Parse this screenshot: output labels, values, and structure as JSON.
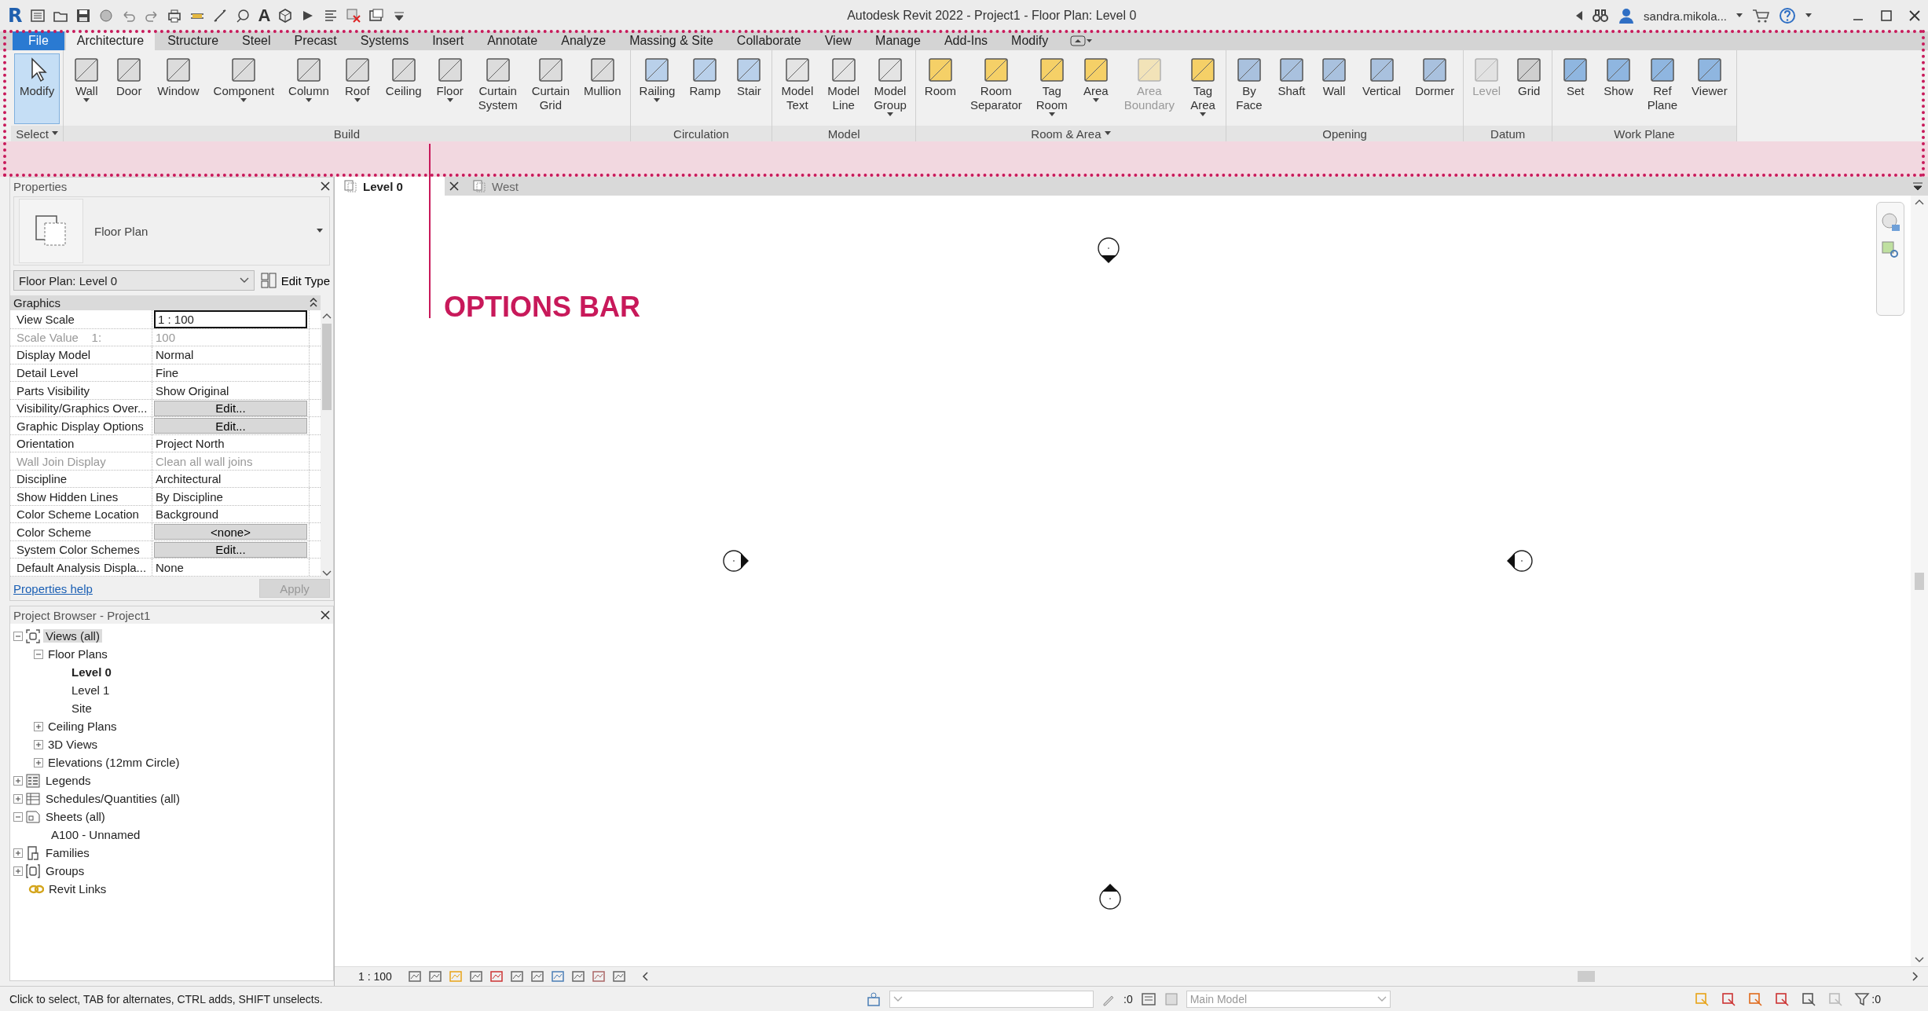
{
  "title_bar": {
    "logo": "R",
    "text_tool": "A",
    "title": "Autodesk Revit 2022 - Project1 - Floor Plan: Level 0",
    "user": "sandra.mikola..."
  },
  "ribbon": {
    "tabs": [
      {
        "label": "File",
        "kind": "application",
        "selected": false
      },
      {
        "label": "Architecture",
        "kind": "tab",
        "selected": true
      },
      {
        "label": "Structure",
        "kind": "tab",
        "selected": false
      },
      {
        "label": "Steel",
        "kind": "tab",
        "selected": false
      },
      {
        "label": "Precast",
        "kind": "tab",
        "selected": false
      },
      {
        "label": "Systems",
        "kind": "tab",
        "selected": false
      },
      {
        "label": "Insert",
        "kind": "tab",
        "selected": false
      },
      {
        "label": "Annotate",
        "kind": "tab",
        "selected": false
      },
      {
        "label": "Analyze",
        "kind": "tab",
        "selected": false
      },
      {
        "label": "Massing & Site",
        "kind": "tab",
        "selected": false
      },
      {
        "label": "Collaborate",
        "kind": "tab",
        "selected": false
      },
      {
        "label": "View",
        "kind": "tab",
        "selected": false
      },
      {
        "label": "Manage",
        "kind": "tab",
        "selected": false
      },
      {
        "label": "Add-Ins",
        "kind": "tab",
        "selected": false
      },
      {
        "label": "Modify",
        "kind": "tab",
        "selected": false
      }
    ],
    "panels": [
      {
        "title": "Select",
        "menu": true,
        "buttons": [
          {
            "label": "Modify",
            "selected": true,
            "disabled": false,
            "dropdown": false
          }
        ]
      },
      {
        "title": "Build",
        "menu": false,
        "buttons": [
          {
            "label": "Wall",
            "selected": false,
            "disabled": false,
            "dropdown": true
          },
          {
            "label": "Door",
            "selected": false,
            "disabled": false,
            "dropdown": false
          },
          {
            "label": "Window",
            "selected": false,
            "disabled": false,
            "dropdown": false
          },
          {
            "label": "Component",
            "selected": false,
            "disabled": false,
            "dropdown": true
          },
          {
            "label": "Column",
            "selected": false,
            "disabled": false,
            "dropdown": true
          },
          {
            "label": "Roof",
            "selected": false,
            "disabled": false,
            "dropdown": true
          },
          {
            "label": "Ceiling",
            "selected": false,
            "disabled": false,
            "dropdown": false
          },
          {
            "label": "Floor",
            "selected": false,
            "disabled": false,
            "dropdown": true
          },
          {
            "label": "Curtain\nSystem",
            "selected": false,
            "disabled": false,
            "dropdown": false
          },
          {
            "label": "Curtain\nGrid",
            "selected": false,
            "disabled": false,
            "dropdown": false
          },
          {
            "label": "Mullion",
            "selected": false,
            "disabled": false,
            "dropdown": false
          }
        ]
      },
      {
        "title": "Circulation",
        "menu": false,
        "buttons": [
          {
            "label": "Railing",
            "selected": false,
            "disabled": false,
            "dropdown": true
          },
          {
            "label": "Ramp",
            "selected": false,
            "disabled": false,
            "dropdown": false
          },
          {
            "label": "Stair",
            "selected": false,
            "disabled": false,
            "dropdown": false
          }
        ]
      },
      {
        "title": "Model",
        "menu": false,
        "buttons": [
          {
            "label": "Model\nText",
            "selected": false,
            "disabled": false,
            "dropdown": false
          },
          {
            "label": "Model\nLine",
            "selected": false,
            "disabled": false,
            "dropdown": false
          },
          {
            "label": "Model\nGroup",
            "selected": false,
            "disabled": false,
            "dropdown": true
          }
        ]
      },
      {
        "title": "Room & Area",
        "menu": true,
        "buttons": [
          {
            "label": "Room",
            "selected": false,
            "disabled": false,
            "dropdown": false
          },
          {
            "label": "Room\nSeparator",
            "selected": false,
            "disabled": false,
            "dropdown": false
          },
          {
            "label": "Tag\nRoom",
            "selected": false,
            "disabled": false,
            "dropdown": true
          },
          {
            "label": "Area",
            "selected": false,
            "disabled": false,
            "dropdown": true
          },
          {
            "label": "Area\nBoundary",
            "selected": false,
            "disabled": true,
            "dropdown": false
          },
          {
            "label": "Tag\nArea",
            "selected": false,
            "disabled": false,
            "dropdown": true
          }
        ]
      },
      {
        "title": "Opening",
        "menu": false,
        "buttons": [
          {
            "label": "By\nFace",
            "selected": false,
            "disabled": false,
            "dropdown": false
          },
          {
            "label": "Shaft",
            "selected": false,
            "disabled": false,
            "dropdown": false
          },
          {
            "label": "Wall",
            "selected": false,
            "disabled": false,
            "dropdown": false
          },
          {
            "label": "Vertical",
            "selected": false,
            "disabled": false,
            "dropdown": false
          },
          {
            "label": "Dormer",
            "selected": false,
            "disabled": false,
            "dropdown": false
          }
        ]
      },
      {
        "title": "Datum",
        "menu": false,
        "buttons": [
          {
            "label": "Level",
            "selected": false,
            "disabled": true,
            "dropdown": false
          },
          {
            "label": "Grid",
            "selected": false,
            "disabled": false,
            "dropdown": false
          }
        ]
      },
      {
        "title": "Work Plane",
        "menu": false,
        "buttons": [
          {
            "label": "Set",
            "selected": false,
            "disabled": false,
            "dropdown": false
          },
          {
            "label": "Show",
            "selected": false,
            "disabled": false,
            "dropdown": false
          },
          {
            "label": "Ref\nPlane",
            "selected": false,
            "disabled": false,
            "dropdown": false
          },
          {
            "label": "Viewer",
            "selected": false,
            "disabled": false,
            "dropdown": false
          }
        ]
      }
    ]
  },
  "annotation": {
    "label": "OPTIONS BAR"
  },
  "properties": {
    "title": "Properties",
    "type_name": "Floor Plan",
    "instance": "Floor Plan: Level 0",
    "edit_type": "Edit Type",
    "group": "Graphics",
    "rows": [
      {
        "name": "View Scale",
        "value": "1 : 100",
        "kind": "field",
        "disabled": false
      },
      {
        "name": "Scale Value    1:",
        "value": "100",
        "kind": "text",
        "disabled": true
      },
      {
        "name": "Display Model",
        "value": "Normal",
        "kind": "text",
        "disabled": false
      },
      {
        "name": "Detail Level",
        "value": "Fine",
        "kind": "text",
        "disabled": false
      },
      {
        "name": "Parts Visibility",
        "value": "Show Original",
        "kind": "text",
        "disabled": false
      },
      {
        "name": "Visibility/Graphics Over...",
        "value": "Edit...",
        "kind": "button",
        "disabled": false
      },
      {
        "name": "Graphic Display Options",
        "value": "Edit...",
        "kind": "button",
        "disabled": false
      },
      {
        "name": "Orientation",
        "value": "Project North",
        "kind": "text",
        "disabled": false
      },
      {
        "name": "Wall Join Display",
        "value": "Clean all wall joins",
        "kind": "text",
        "disabled": true
      },
      {
        "name": "Discipline",
        "value": "Architectural",
        "kind": "text",
        "disabled": false
      },
      {
        "name": "Show Hidden Lines",
        "value": "By Discipline",
        "kind": "text",
        "disabled": false
      },
      {
        "name": "Color Scheme Location",
        "value": "Background",
        "kind": "text",
        "disabled": false
      },
      {
        "name": "Color Scheme",
        "value": "<none>",
        "kind": "button",
        "disabled": false
      },
      {
        "name": "System Color Schemes",
        "value": "Edit...",
        "kind": "button",
        "disabled": false
      },
      {
        "name": "Default Analysis Displa...",
        "value": "None",
        "kind": "text",
        "disabled": false
      }
    ],
    "help": "Properties help",
    "apply": {
      "label": "Apply",
      "disabled": true
    }
  },
  "project_browser": {
    "title": "Project Browser - Project1",
    "items": [
      {
        "label": "Views (all)",
        "kind": "views",
        "expanded": true,
        "selected": true,
        "current": false,
        "children": [
          {
            "label": "Floor Plans",
            "expanded": true,
            "selected": false,
            "current": false,
            "children": [
              {
                "label": "Level 0",
                "selected": false,
                "current": true
              },
              {
                "label": "Level 1",
                "selected": false,
                "current": false
              },
              {
                "label": "Site",
                "selected": false,
                "current": false
              }
            ]
          },
          {
            "label": "Ceiling Plans",
            "expanded": false,
            "selected": false,
            "current": false
          },
          {
            "label": "3D Views",
            "expanded": false,
            "selected": false,
            "current": false
          },
          {
            "label": "Elevations (12mm Circle)",
            "expanded": false,
            "selected": false,
            "current": false
          }
        ]
      },
      {
        "label": "Legends",
        "kind": "legends",
        "expanded": false,
        "selected": false,
        "current": false
      },
      {
        "label": "Schedules/Quantities (all)",
        "kind": "schedules",
        "expanded": false,
        "selected": false,
        "current": false
      },
      {
        "label": "Sheets (all)",
        "kind": "sheets",
        "expanded": true,
        "selected": false,
        "current": false,
        "children": [
          {
            "label": "A100 - Unnamed",
            "selected": false,
            "current": false
          }
        ]
      },
      {
        "label": "Families",
        "kind": "families",
        "expanded": false,
        "selected": false,
        "current": false
      },
      {
        "label": "Groups",
        "kind": "groups",
        "expanded": false,
        "selected": false,
        "current": false
      },
      {
        "label": "Revit Links",
        "kind": "links",
        "selected": false,
        "current": false
      }
    ]
  },
  "view_tabs": [
    {
      "label": "Level 0",
      "selected": true
    },
    {
      "label": "West",
      "selected": false
    }
  ],
  "canvas": {
    "elevation_markers": [
      {
        "kind": "south"
      },
      {
        "kind": "east"
      },
      {
        "kind": "west"
      },
      {
        "kind": "north"
      }
    ]
  },
  "view_control_bar": {
    "scale": "1 : 100"
  },
  "status_bar": {
    "message": "Click to select, TAB for alternates, CTRL adds, SHIFT unselects.",
    "workset_count": ":0",
    "design_option": "Main Model",
    "filter_count": ":0"
  }
}
